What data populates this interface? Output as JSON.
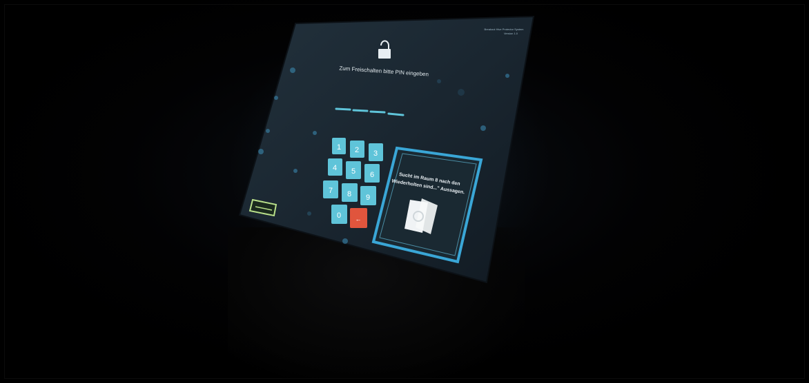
{
  "screen": {
    "header_text": "Breakout Hive Protector System",
    "header_sub": "Version 1.0",
    "prompt": "Zum Freischalten bitte PIN eingeben",
    "pin_slots": 4
  },
  "keypad": {
    "keys": [
      "1",
      "2",
      "3",
      "4",
      "5",
      "6",
      "7",
      "8",
      "9",
      "0"
    ],
    "delete_label": "←"
  },
  "hint": {
    "text_line1": "Sucht im Raum 8 nach den",
    "text_line2": "Wiederholten sind...\" Aussagen."
  },
  "colors": {
    "key_bg": "#5fc4d9",
    "delete_bg": "#e0553d",
    "accent": "#4fc7e8",
    "panel_border": "#3aa6d6"
  }
}
